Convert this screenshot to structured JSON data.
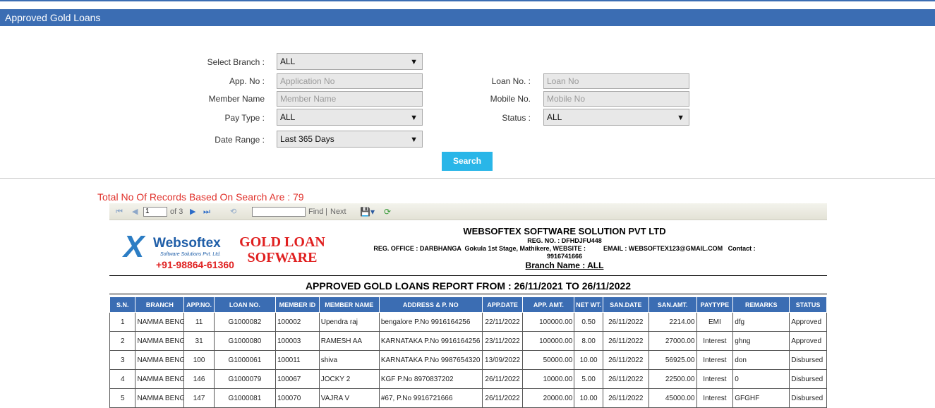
{
  "page": {
    "title": "Approved Gold Loans"
  },
  "form": {
    "branch": {
      "label": "Select Branch :",
      "value": "ALL"
    },
    "app_no": {
      "label": "App. No :",
      "placeholder": "Application No"
    },
    "member_name": {
      "label": "Member Name",
      "placeholder": "Member Name"
    },
    "pay_type": {
      "label": "Pay Type :",
      "value": "ALL"
    },
    "date_range": {
      "label": "Date Range :",
      "value": "Last 365 Days"
    },
    "loan_no": {
      "label": "Loan No. :",
      "placeholder": "Loan No"
    },
    "mobile_no": {
      "label": "Mobile No.",
      "placeholder": "Mobile No"
    },
    "status": {
      "label": "Status :",
      "value": "ALL"
    },
    "search_label": "Search"
  },
  "records_text": "Total No Of Records Based On Search Are : 79",
  "report_toolbar": {
    "page": "1",
    "of_pages": "of 3",
    "find": "Find",
    "separator": "|",
    "next": "Next"
  },
  "report": {
    "logo": {
      "name": "Websoftex",
      "tagline": "Software Solutions Pvt. Ltd.",
      "phone": "+91-98864-61360"
    },
    "product_line1": "GOLD LOAN",
    "product_line2": "SOFWARE",
    "company_name": "WEBSOFTEX SOFTWARE SOLUTION PVT LTD",
    "reg_no": "REG. NO. : DFHDJFU448",
    "office": "REG. OFFICE : DARBHANGA  Gokula 1st Stage, Mathikere, WEBSITE :          EMAIL : WEBSOFTEX123@GMAIL.COM   Contact :",
    "contact": "9916741666",
    "branch_name": "Branch Name : ALL",
    "title": "APPROVED GOLD LOANS REPORT FROM : 26/11/2021 TO 26/11/2022",
    "columns": [
      "S.N.",
      "BRANCH",
      "APP.NO.",
      "LOAN NO.",
      "MEMBER ID",
      "MEMBER NAME",
      "ADDRESS & P. NO",
      "APP.DATE",
      "APP. AMT.",
      "NET WT.",
      "SAN.DATE",
      "SAN.AMT.",
      "PAYTYPE",
      "REMARKS",
      "STATUS"
    ],
    "rows": [
      [
        "1",
        "NAMMA BENGALURU",
        "11",
        "G1000082",
        "100002",
        "Upendra raj",
        "bengalore  P.No 9916164256",
        "22/11/2022",
        "100000.00",
        "0.50",
        "26/11/2022",
        "2214.00",
        "EMI",
        "dfg",
        "Approved"
      ],
      [
        "2",
        "NAMMA BENGALURU",
        "31",
        "G1000080",
        "100003",
        "RAMESH AA",
        "KARNATAKA  P.No 9916164256",
        "23/11/2022",
        "100000.00",
        "8.00",
        "26/11/2022",
        "27000.00",
        "Interest",
        "ghng",
        "Approved"
      ],
      [
        "3",
        "NAMMA BENGALURU",
        "100",
        "G1000061",
        "100011",
        "shiva",
        "KARNATAKA  P.No 9987654320",
        "13/09/2022",
        "50000.00",
        "10.00",
        "26/11/2022",
        "56925.00",
        "Interest",
        "don",
        "Disbursed"
      ],
      [
        "4",
        "NAMMA BENGALURU",
        "146",
        "G1000079",
        "100067",
        "JOCKY 2",
        "KGF  P.No 8970837202",
        "26/11/2022",
        "10000.00",
        "5.00",
        "26/11/2022",
        "22500.00",
        "Interest",
        "0",
        "Disbursed"
      ],
      [
        "5",
        "NAMMA BENGALURU",
        "147",
        "G1000081",
        "100070",
        "VAJRA V",
        "#67,  P.No 9916721666",
        "26/11/2022",
        "20000.00",
        "10.00",
        "26/11/2022",
        "45000.00",
        "Interest",
        "GFGHF",
        "Disbursed"
      ]
    ]
  },
  "colors": {
    "header_blue": "#3b6db3",
    "button_cyan": "#29b6e8",
    "records_red": "#e0312b"
  }
}
